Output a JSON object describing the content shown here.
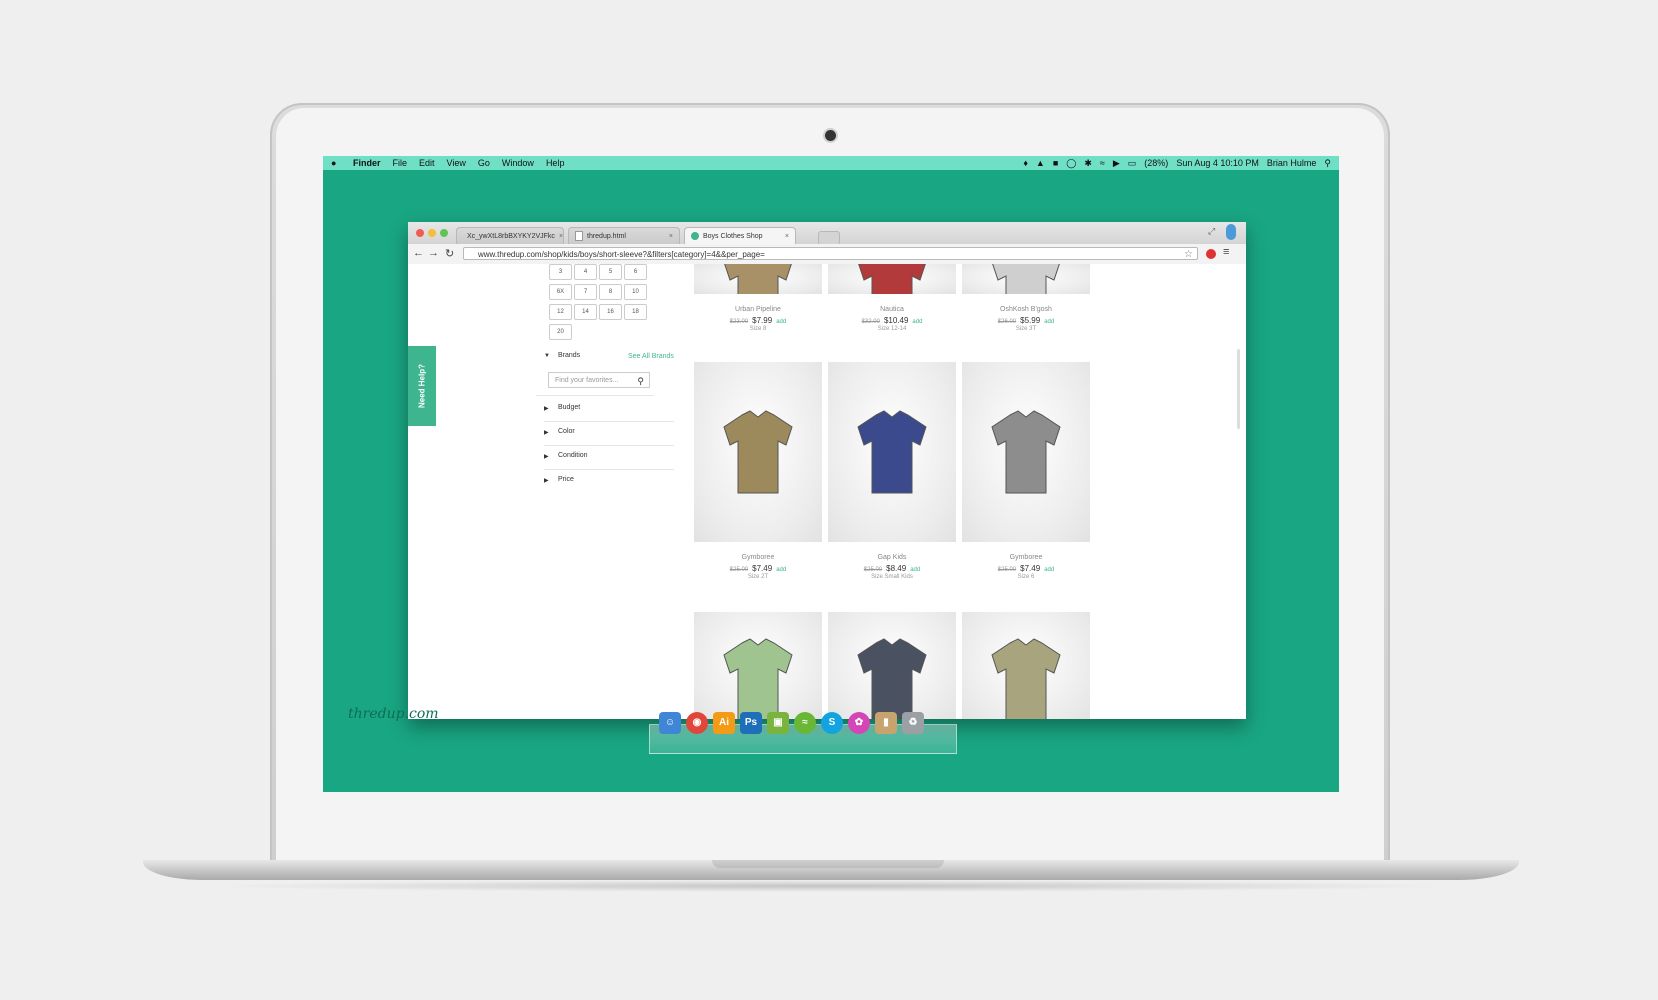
{
  "menubar": {
    "items": [
      "Finder",
      "File",
      "Edit",
      "View",
      "Go",
      "Window",
      "Help"
    ],
    "battery": "(28%)",
    "clock": "Sun Aug 4  10:10 PM",
    "user": "Brian Hulme"
  },
  "browser": {
    "tabs": [
      {
        "label": "Xc_ywXtL8rbBXYKY2VJFkc"
      },
      {
        "label": "thredup.html"
      },
      {
        "label": "Boys Clothes Shop"
      }
    ],
    "url": "www.thredup.com/shop/kids/boys/short-sleeve?&filters[category]=4&&per_page="
  },
  "sidebar": {
    "need_help": "Need Help?",
    "sizes": [
      "3",
      "4",
      "5",
      "6",
      "6X",
      "7",
      "8",
      "10",
      "12",
      "14",
      "16",
      "18",
      "20"
    ],
    "brands_label": "Brands",
    "see_all_brands": "See All Brands",
    "brand_search_placeholder": "Find your favorites...",
    "filters": [
      "Budget",
      "Color",
      "Condition",
      "Price"
    ]
  },
  "products": [
    {
      "brand": "Urban Pipeline",
      "orig": "$23.00",
      "price": "$7.99",
      "add": "add",
      "size": "Size 8",
      "color": "#a99167"
    },
    {
      "brand": "Nautica",
      "orig": "$32.00",
      "price": "$10.49",
      "add": "add",
      "size": "Size 12-14",
      "color": "#b23a3a"
    },
    {
      "brand": "OshKosh B'gosh",
      "orig": "$26.00",
      "price": "$5.99",
      "add": "add",
      "size": "Size 3T",
      "color": "#cfcfcf"
    },
    {
      "brand": "Gymboree",
      "orig": "$25.00",
      "price": "$7.49",
      "add": "add",
      "size": "Size 2T",
      "color": "#9c8a5c"
    },
    {
      "brand": "Gap Kids",
      "orig": "$25.00",
      "price": "$8.49",
      "add": "add",
      "size": "Size Small Kids",
      "color": "#3b4a8c"
    },
    {
      "brand": "Gymboree",
      "orig": "$25.00",
      "price": "$7.49",
      "add": "add",
      "size": "Size 6",
      "color": "#8d8d8d"
    },
    {
      "color": "#9fc48f"
    },
    {
      "color": "#4a5160"
    },
    {
      "color": "#a8a47e"
    }
  ],
  "desktop": {
    "logo": "thredup.com"
  },
  "dock": [
    "finder-icon",
    "chrome-icon",
    "illustrator-icon",
    "photoshop-icon",
    "android-icon",
    "spotify-icon",
    "skype-icon",
    "flower-app-icon",
    "folder-icon",
    "trash-icon"
  ]
}
